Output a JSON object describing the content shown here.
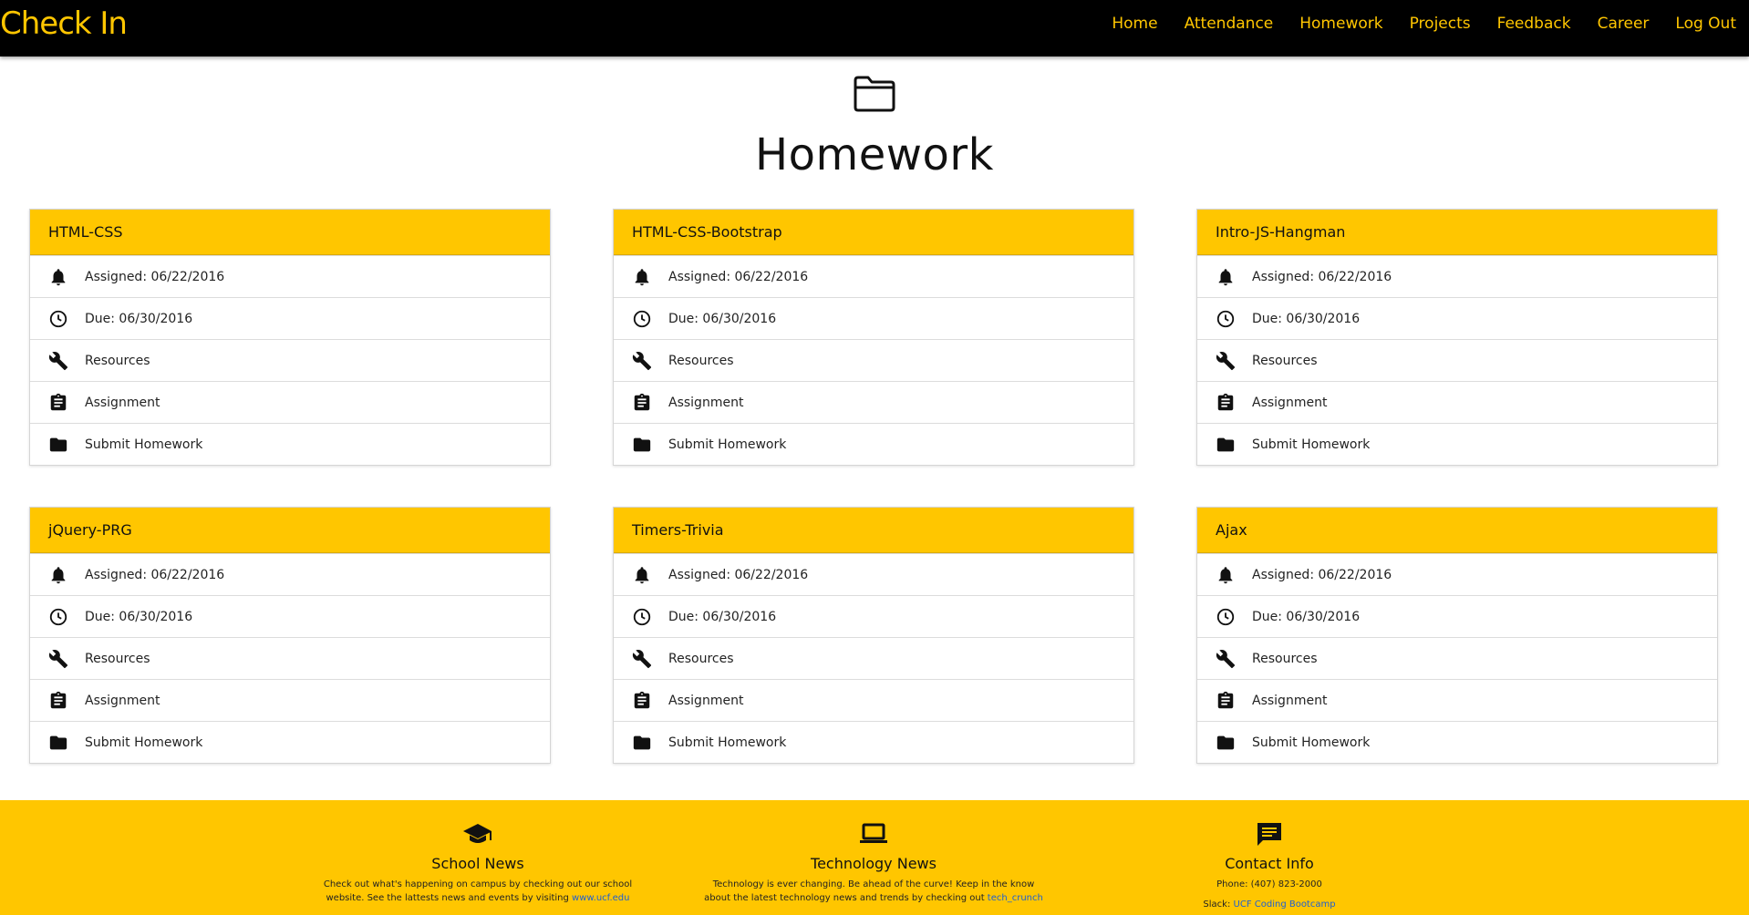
{
  "brand": "Check In",
  "nav": [
    "Home",
    "Attendance",
    "Homework",
    "Projects",
    "Feedback",
    "Career",
    "Log Out"
  ],
  "page": {
    "title": "Homework",
    "icon": "folder-open-outline-icon"
  },
  "theme": {
    "accent": "#ffc600",
    "nav_bg": "#000000",
    "link": "#1c5fd4"
  },
  "cards": [
    {
      "title": "HTML-CSS",
      "assigned": "Assigned: 06/22/2016",
      "due": "Due: 06/30/2016",
      "resources": "Resources",
      "assignment": "Assignment",
      "submit": "Submit Homework"
    },
    {
      "title": "HTML-CSS-Bootstrap",
      "assigned": "Assigned: 06/22/2016",
      "due": "Due: 06/30/2016",
      "resources": "Resources",
      "assignment": "Assignment",
      "submit": "Submit Homework"
    },
    {
      "title": "Intro-JS-Hangman",
      "assigned": "Assigned: 06/22/2016",
      "due": "Due: 06/30/2016",
      "resources": "Resources",
      "assignment": "Assignment",
      "submit": "Submit Homework"
    },
    {
      "title": "jQuery-PRG",
      "assigned": "Assigned: 06/22/2016",
      "due": "Due: 06/30/2016",
      "resources": "Resources",
      "assignment": "Assignment",
      "submit": "Submit Homework"
    },
    {
      "title": "Timers-Trivia",
      "assigned": "Assigned: 06/22/2016",
      "due": "Due: 06/30/2016",
      "resources": "Resources",
      "assignment": "Assignment",
      "submit": "Submit Homework"
    },
    {
      "title": "Ajax",
      "assigned": "Assigned: 06/22/2016",
      "due": "Due: 06/30/2016",
      "resources": "Resources",
      "assignment": "Assignment",
      "submit": "Submit Homework"
    }
  ],
  "footer": {
    "school": {
      "title": "School News",
      "text": "Check out what's happening on campus by checking out our school website. See the lattests news and events by visiting ",
      "link": "www.ucf.edu",
      "icon": "graduation-cap-icon"
    },
    "tech": {
      "title": "Technology News",
      "text": "Technology is ever changing. Be ahead of the curve! Keep in the know about the latest technology news and trends by checking out ",
      "link": "tech_crunch",
      "icon": "laptop-icon"
    },
    "contact": {
      "title": "Contact Info",
      "phone": "Phone: (407) 823-2000",
      "slack_label": "Slack: ",
      "slack_link": "UCF Coding Bootcamp",
      "icon": "chat-icon"
    }
  }
}
